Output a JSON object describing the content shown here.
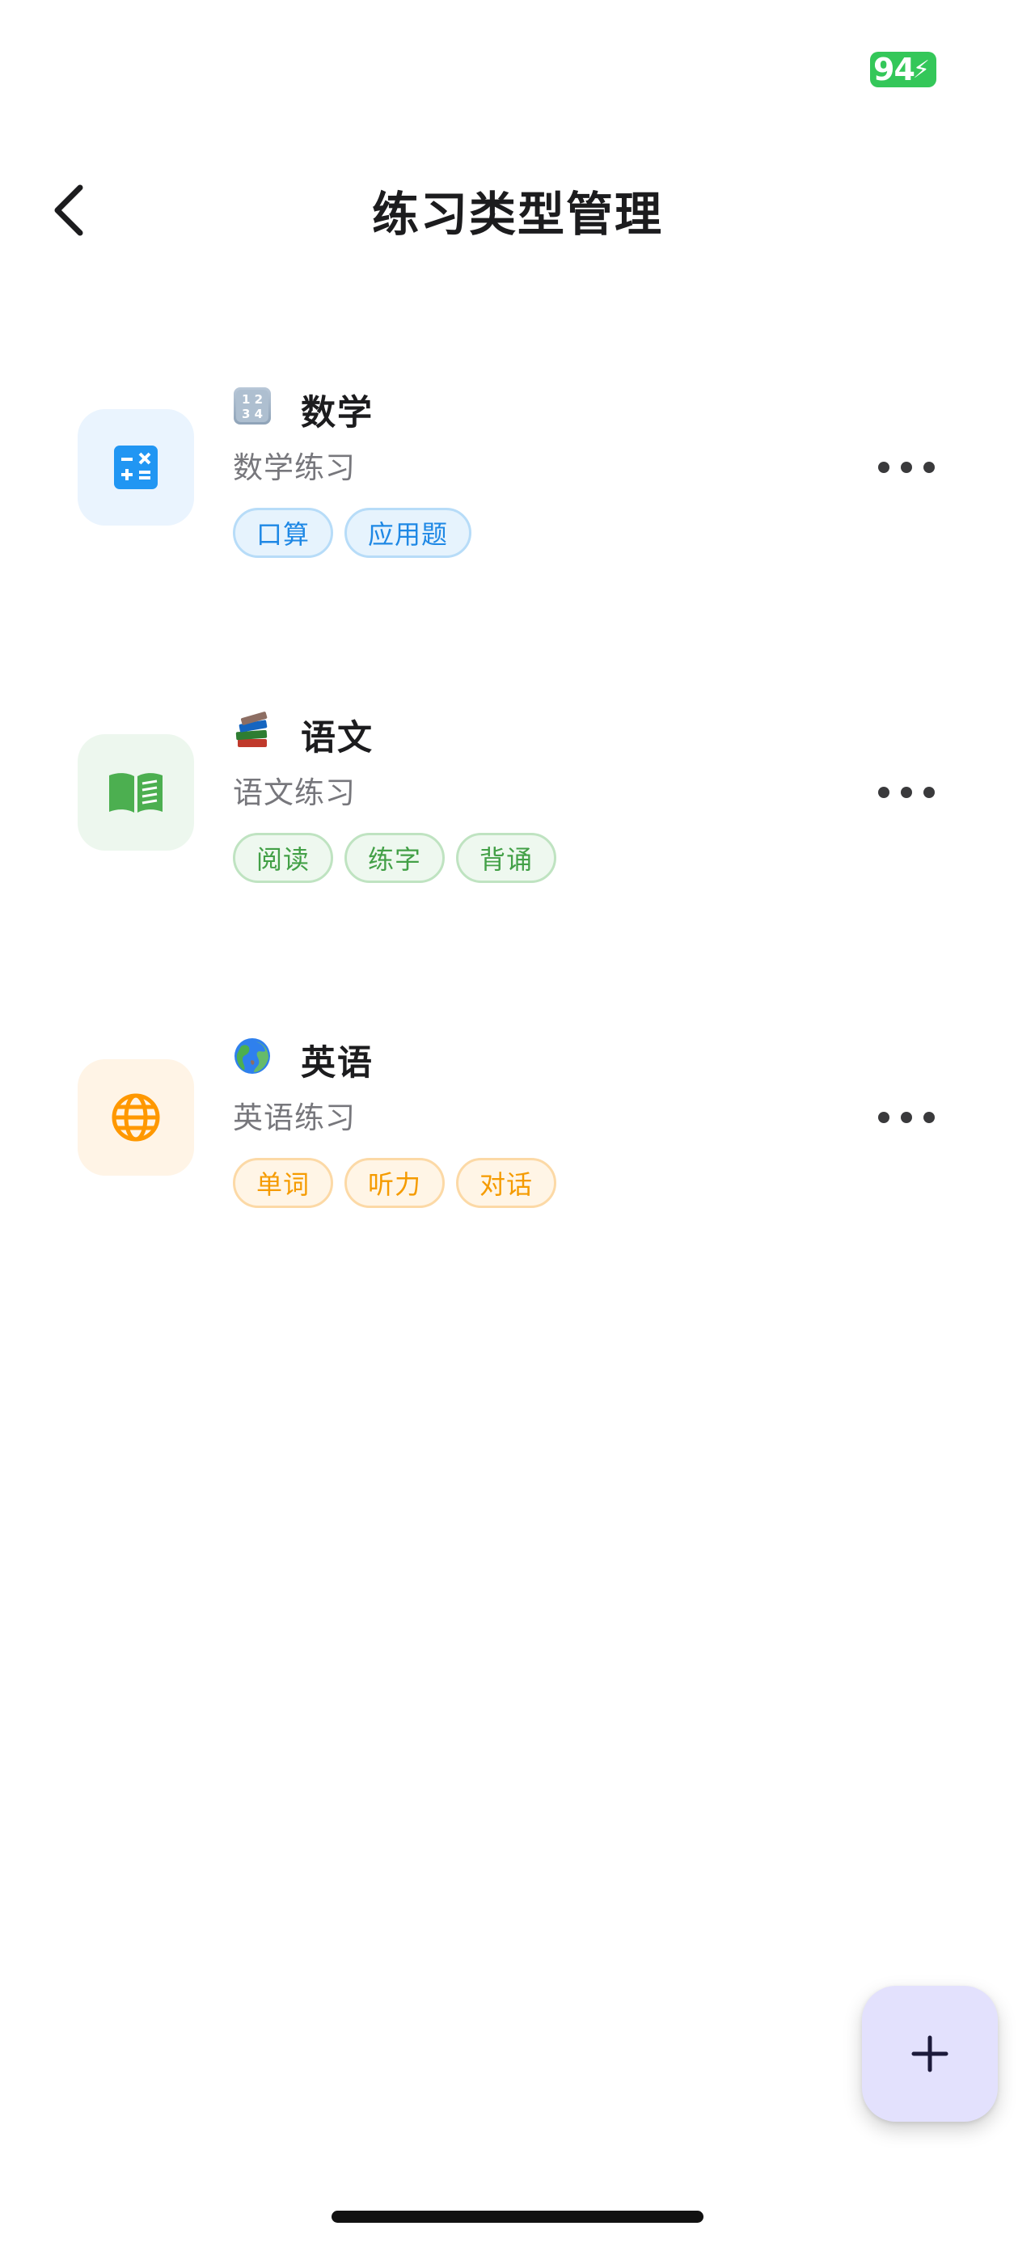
{
  "status_bar": {
    "battery_level": "94"
  },
  "header": {
    "title": "练习类型管理"
  },
  "practice_types": [
    {
      "name": "数学",
      "emoji": "numbers-keycap-emoji",
      "description": "数学练习",
      "icon": "calculator-icon",
      "accent": "#2196f3",
      "icon_bg": "#eaf4fe",
      "tag_bg": "#e6f3fd",
      "tag_border": "#b7dcf8",
      "tag_text": "#1e88e5",
      "tags": [
        "口算",
        "应用题"
      ]
    },
    {
      "name": "语文",
      "emoji": "books-emoji",
      "description": "语文练习",
      "icon": "open-book-icon",
      "accent": "#4caf50",
      "icon_bg": "#edf7ee",
      "tag_bg": "#eef8ef",
      "tag_border": "#bfe3c1",
      "tag_text": "#43a047",
      "tags": [
        "阅读",
        "练字",
        "背诵"
      ]
    },
    {
      "name": "英语",
      "emoji": "globe-emoji",
      "description": "英语练习",
      "icon": "globe-icon",
      "accent": "#ff9800",
      "icon_bg": "#fff4e6",
      "tag_bg": "#fff5e6",
      "tag_border": "#fcd9a6",
      "tag_text": "#f59b00",
      "tags": [
        "单词",
        "听力",
        "对话"
      ]
    }
  ],
  "fab": {
    "icon": "plus-icon"
  }
}
